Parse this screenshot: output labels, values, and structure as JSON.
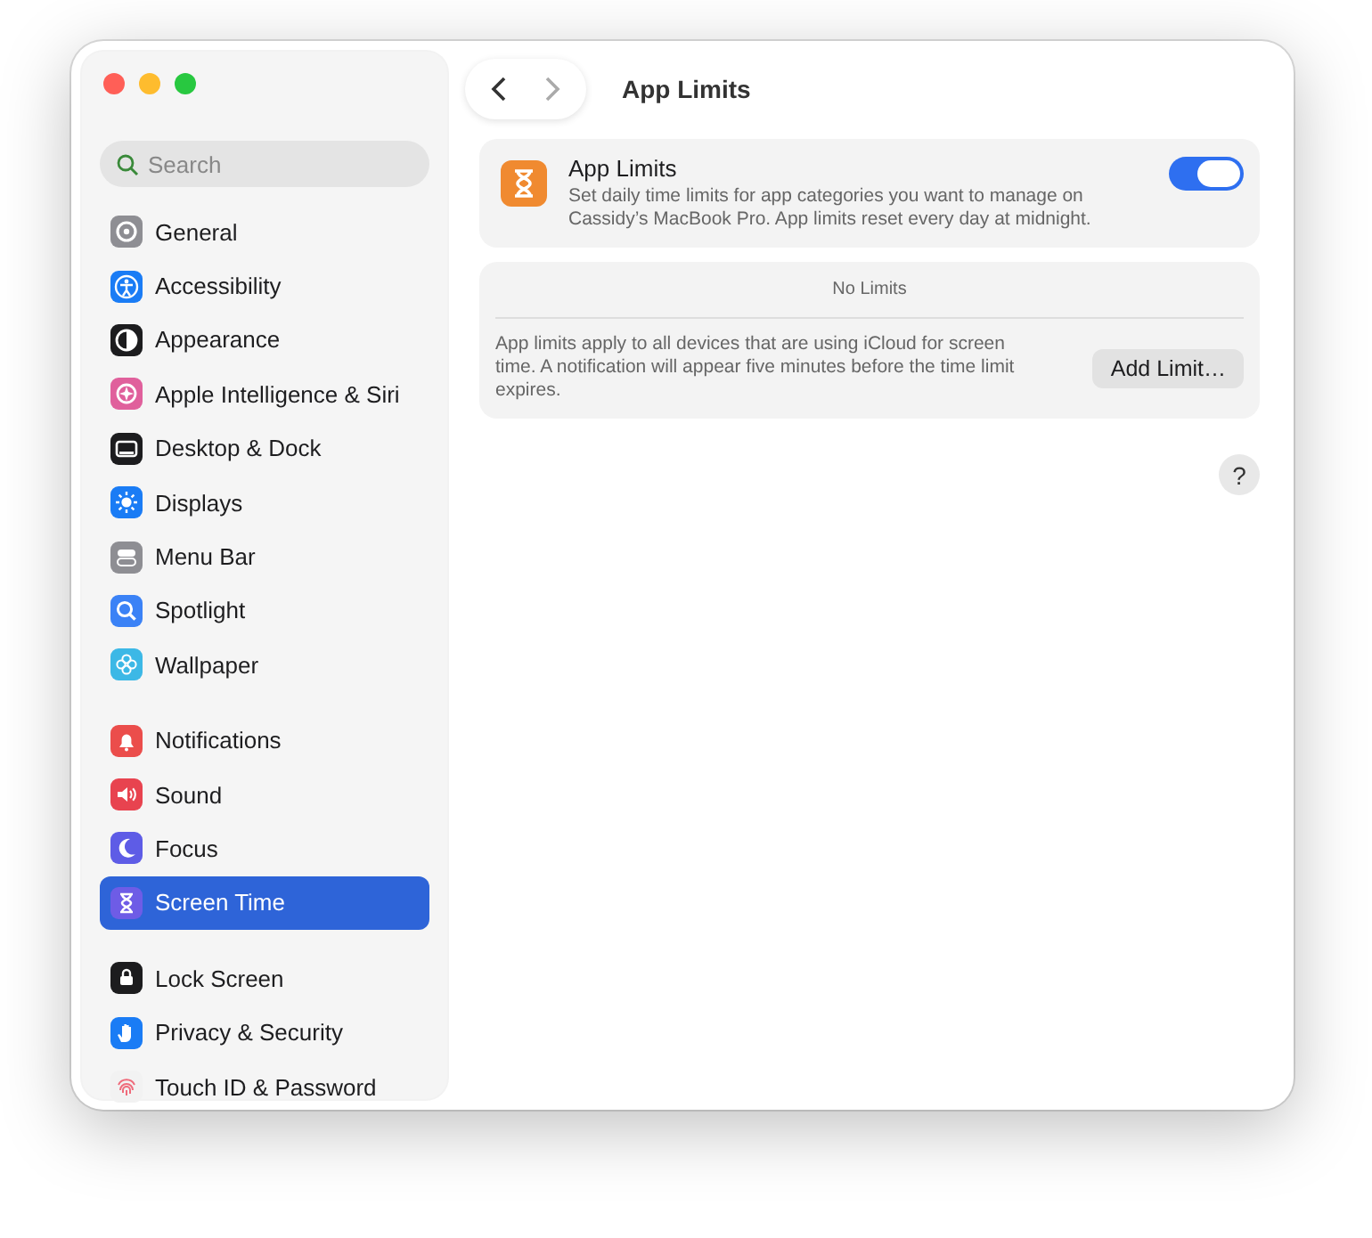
{
  "sidebar": {
    "search": {
      "placeholder": "Search"
    },
    "groups": [
      {
        "items": [
          {
            "label": "General",
            "kind": "gear",
            "color": "#8e8e93",
            "selected": false
          },
          {
            "label": "Accessibility",
            "kind": "person",
            "color": "#1a7cf5",
            "selected": false
          },
          {
            "label": "Appearance",
            "kind": "contrast",
            "color": "#1c1c1e",
            "selected": false
          },
          {
            "label": "Apple Intelligence & Siri",
            "kind": "sparkle",
            "color": "#e0609c",
            "selected": false
          },
          {
            "label": "Desktop & Dock",
            "kind": "dock",
            "color": "#1c1c1e",
            "selected": false
          },
          {
            "label": "Displays",
            "kind": "sun",
            "color": "#1a7cf5",
            "selected": false
          },
          {
            "label": "Menu Bar",
            "kind": "toggles",
            "color": "#8e8e93",
            "selected": false
          },
          {
            "label": "Spotlight",
            "kind": "magnifier",
            "color": "#3b82f6",
            "selected": false
          },
          {
            "label": "Wallpaper",
            "kind": "flower",
            "color": "#3cb8e6",
            "selected": false
          }
        ]
      },
      {
        "items": [
          {
            "label": "Notifications",
            "kind": "bell",
            "color": "#eb4d4b",
            "selected": false
          },
          {
            "label": "Sound",
            "kind": "speaker",
            "color": "#e8434f",
            "selected": false
          },
          {
            "label": "Focus",
            "kind": "moon",
            "color": "#5e5ce6",
            "selected": false
          },
          {
            "label": "Screen Time",
            "kind": "hourglass",
            "color": "#6e5ce6",
            "selected": true
          }
        ]
      },
      {
        "items": [
          {
            "label": "Lock Screen",
            "kind": "lock",
            "color": "#1c1c1e",
            "selected": false
          },
          {
            "label": "Privacy & Security",
            "kind": "hand",
            "color": "#1a7cf5",
            "selected": false
          },
          {
            "label": "Touch ID & Password",
            "kind": "fingerprint",
            "color": "#f2f2f2",
            "selected": false
          }
        ]
      }
    ]
  },
  "toolbar": {
    "title": "App Limits"
  },
  "app_limits": {
    "title": "App Limits",
    "description": "Set daily time limits for app categories you want to manage on Cassidy’s MacBook Pro. App limits reset every day at midnight.",
    "on": true
  },
  "limits": {
    "empty_text": "No Limits",
    "note": "App limits apply to all devices that are using iCloud for screen time. A notification will appear five minutes before the time limit expires.",
    "button": "Add Limit…"
  },
  "help": "?"
}
